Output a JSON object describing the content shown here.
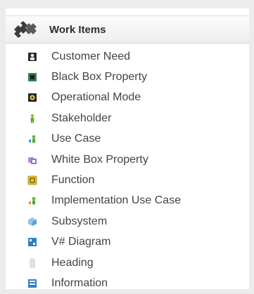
{
  "header": {
    "title": "Work Items",
    "icon": "puzzle-pieces-icon"
  },
  "items": [
    {
      "label": "Customer Need",
      "icon": "customer-need-icon"
    },
    {
      "label": "Black Box Property",
      "icon": "black-box-property-icon"
    },
    {
      "label": "Operational Mode",
      "icon": "operational-mode-icon"
    },
    {
      "label": "Stakeholder",
      "icon": "stakeholder-icon"
    },
    {
      "label": "Use Case",
      "icon": "use-case-icon"
    },
    {
      "label": "White Box Property",
      "icon": "white-box-property-icon"
    },
    {
      "label": "Function",
      "icon": "function-icon"
    },
    {
      "label": "Implementation Use Case",
      "icon": "implementation-use-case-icon"
    },
    {
      "label": "Subsystem",
      "icon": "subsystem-icon"
    },
    {
      "label": "V# Diagram",
      "icon": "v-diagram-icon"
    },
    {
      "label": "Heading",
      "icon": "heading-icon"
    },
    {
      "label": "Information",
      "icon": "information-icon"
    }
  ]
}
